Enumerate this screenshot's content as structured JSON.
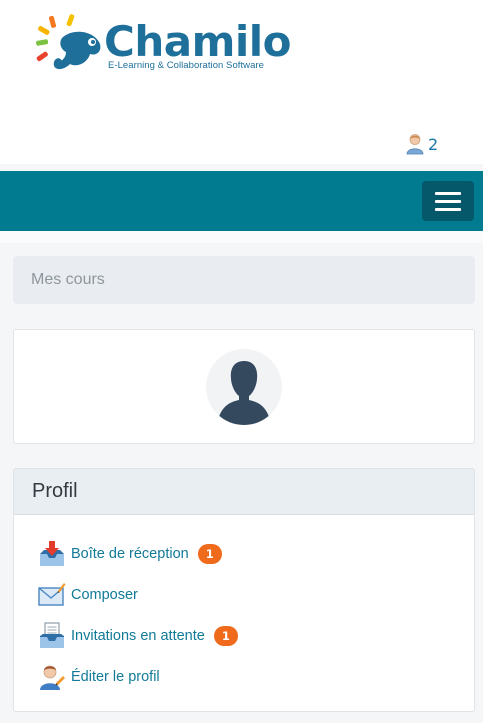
{
  "brand": {
    "name": "Chamilo",
    "tagline": "E-Learning & Collaboration Software"
  },
  "header": {
    "users_online_count": "2"
  },
  "navbar": {
    "menu_icon": "hamburger-menu-icon"
  },
  "mes_cours": {
    "label": "Mes cours"
  },
  "profile_card": {
    "avatar_icon": "default-avatar-icon"
  },
  "profil": {
    "title": "Profil",
    "items": [
      {
        "label": "Boîte de réception",
        "icon": "inbox-icon",
        "badge": "1"
      },
      {
        "label": "Composer",
        "icon": "compose-envelope-icon"
      },
      {
        "label": "Invitations en attente",
        "icon": "invitations-icon",
        "badge": "1"
      },
      {
        "label": "Éditer le profil",
        "icon": "edit-profile-icon"
      }
    ]
  },
  "colors": {
    "navbar": "#007b8f",
    "link": "#117a97",
    "badge": "#f06a1b",
    "brand": "#1e6f9a"
  }
}
